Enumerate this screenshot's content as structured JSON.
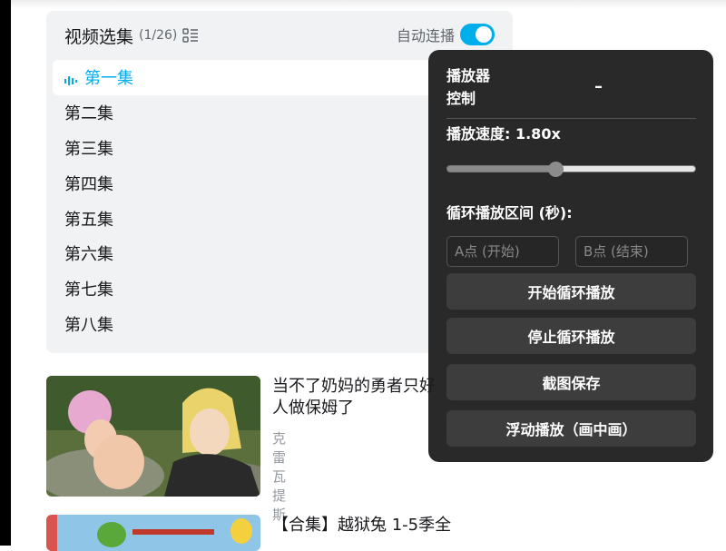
{
  "episodes": {
    "title": "视频选集",
    "count": "(1/26)",
    "autoplay_label": "自动连播",
    "autoplay_on": true,
    "items": [
      "第一集",
      "第二集",
      "第三集",
      "第四集",
      "第五集",
      "第六集",
      "第七集",
      "第八集"
    ],
    "active_index": 0
  },
  "recommended": [
    {
      "title": "当不了奶妈的勇者只好\n人做保姆了",
      "author": "克雷瓦提斯"
    },
    {
      "title": "【合集】越狱兔 1-5季全"
    }
  ],
  "player_control": {
    "title": "播放器\n控制",
    "minimize": "–",
    "speed_label": "播放速度: 1.80x",
    "speed_fraction": 0.44,
    "loop_label": "循环播放区间 (秒):",
    "a_placeholder": "A点 (开始)",
    "b_placeholder": "B点 (结束)",
    "buttons": [
      "开始循环播放",
      "停止循环播放",
      "截图保存",
      "浮动播放（画中画）"
    ]
  },
  "colors": {
    "accent": "#00aeec",
    "panel": "#f1f2f3",
    "overlay": "#1c1c1c"
  }
}
